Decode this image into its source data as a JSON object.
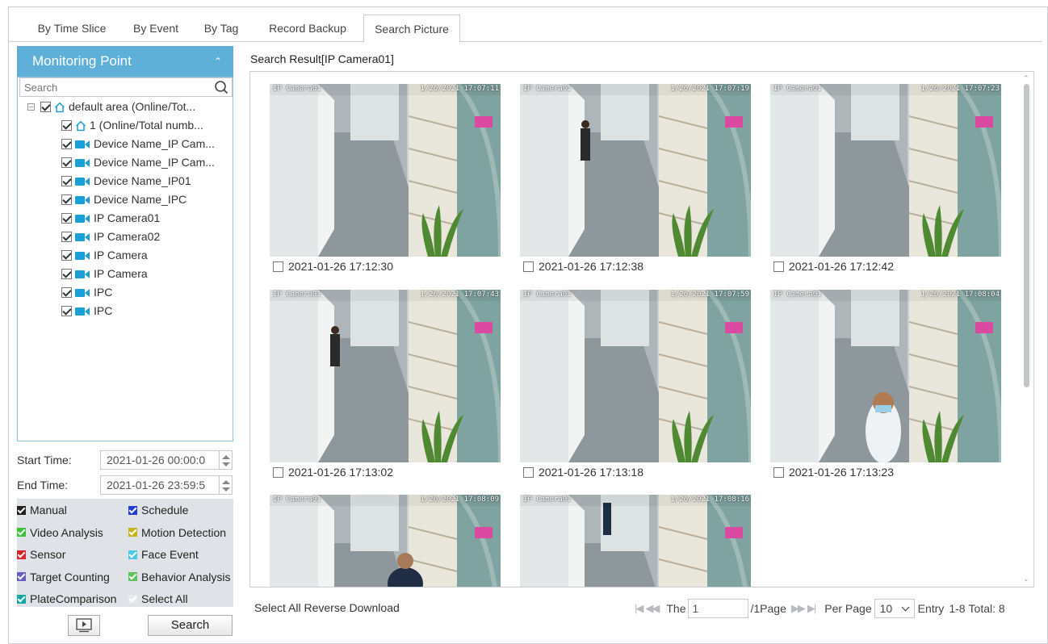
{
  "tabs": [
    {
      "label": "By Time Slice"
    },
    {
      "label": "By Event"
    },
    {
      "label": "By Tag"
    },
    {
      "label": "Record Backup"
    },
    {
      "label": "Search Picture"
    }
  ],
  "sidebar": {
    "header": "Monitoring Point",
    "search_placeholder": "Search",
    "tree": [
      {
        "label": "default area (Online/Tot...",
        "icon": "home-icon"
      },
      {
        "label": "1 (Online/Total numb...",
        "icon": "home-icon"
      },
      {
        "label": "Device Name_IP Cam...",
        "icon": "camera-icon"
      },
      {
        "label": "Device Name_IP Cam...",
        "icon": "camera-icon"
      },
      {
        "label": "Device Name_IP01",
        "icon": "camera-icon"
      },
      {
        "label": "Device Name_IPC",
        "icon": "camera-icon"
      },
      {
        "label": "IP Camera01",
        "icon": "camera-icon"
      },
      {
        "label": "IP Camera02",
        "icon": "camera-icon"
      },
      {
        "label": "IP Camera",
        "icon": "camera-icon"
      },
      {
        "label": "IP Camera",
        "icon": "camera-icon"
      },
      {
        "label": "IPC",
        "icon": "camera-icon"
      },
      {
        "label": "IPC",
        "icon": "camera-icon"
      }
    ],
    "start_label": "Start Time:",
    "start_value": "2021-01-26 00:00:0",
    "end_label": "End Time:",
    "end_value": "2021-01-26 23:59:5",
    "event_types": [
      {
        "label": "Manual",
        "color": "#222222"
      },
      {
        "label": "Schedule",
        "color": "#1f3fd1"
      },
      {
        "label": "Video Analysis",
        "color": "#3cc03c"
      },
      {
        "label": "Motion Detection",
        "color": "#c9b21a"
      },
      {
        "label": "Sensor",
        "color": "#d8252a"
      },
      {
        "label": "Face Event",
        "color": "#4cc8e8"
      },
      {
        "label": "Target Counting",
        "color": "#6a5fc0"
      },
      {
        "label": "Behavior Analysis",
        "color": "#5cc45a"
      },
      {
        "label": "PlateComparison",
        "color": "#16a9a8"
      },
      {
        "label": "Select All",
        "color": "#e8eaec"
      }
    ],
    "search_button": "Search"
  },
  "result": {
    "title": "Search Result[IP Camera01]",
    "overlay_name": "IP Camera01",
    "pictures": [
      {
        "timestamp": "2021-01-26 17:12:30",
        "overlay_time": "1/26/2021 17:07:11"
      },
      {
        "timestamp": "2021-01-26 17:12:38",
        "overlay_time": "1/26/2021 17:07:19"
      },
      {
        "timestamp": "2021-01-26 17:12:42",
        "overlay_time": "1/26/2021 17:07:23"
      },
      {
        "timestamp": "2021-01-26 17:13:02",
        "overlay_time": "1/26/2021 17:07:43"
      },
      {
        "timestamp": "2021-01-26 17:13:18",
        "overlay_time": "1/26/2021 17:07:59"
      },
      {
        "timestamp": "2021-01-26 17:13:23",
        "overlay_time": "1/26/2021 17:08:04"
      },
      {
        "timestamp": "",
        "overlay_time": "1/26/2021 17:08:09"
      },
      {
        "timestamp": "",
        "overlay_time": "1/26/2021 17:08:16"
      }
    ]
  },
  "footer": {
    "select_all": "Select All",
    "reverse": "Reverse",
    "download": "Download",
    "the": "The",
    "page_value": "1",
    "page_total": "/1Page",
    "per_page": "Per Page",
    "per_page_value": "10",
    "entry": "Entry",
    "range": "1-8",
    "total": "Total: 8"
  }
}
